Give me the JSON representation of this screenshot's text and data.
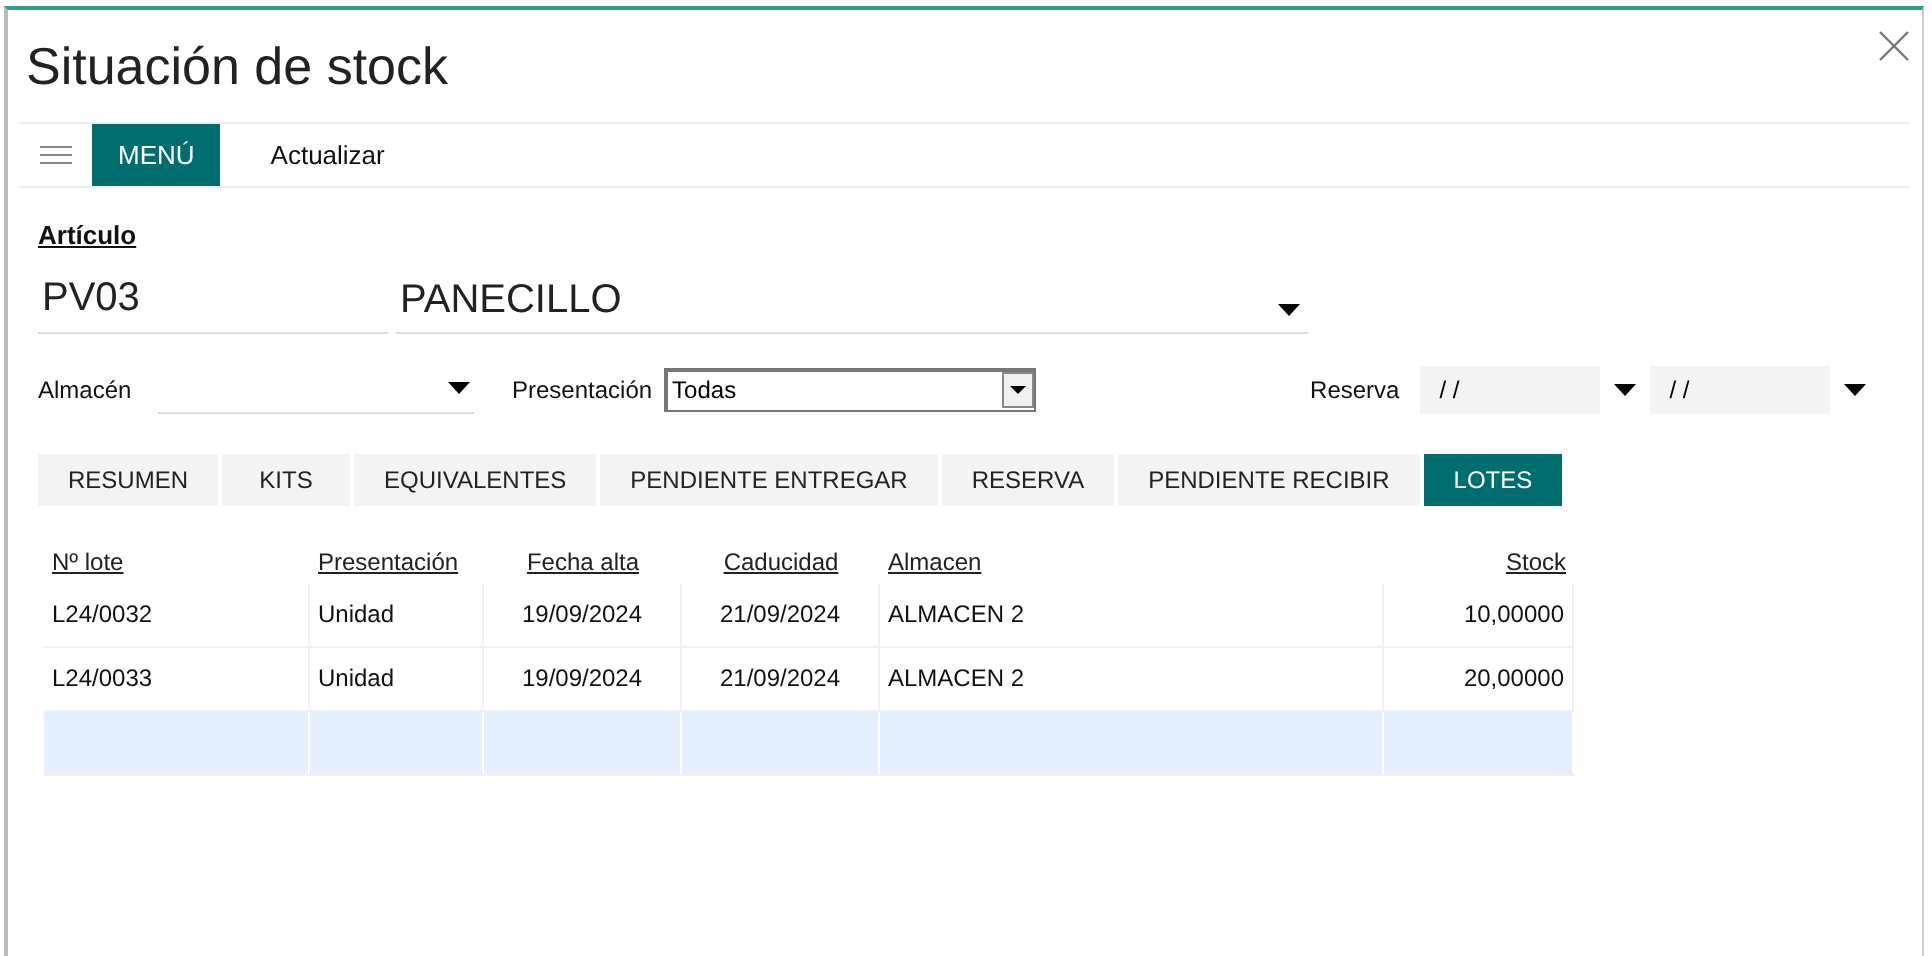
{
  "window": {
    "title": "Situación de stock"
  },
  "toolbar": {
    "menu_button": "MENÚ",
    "actions": [
      "Actualizar"
    ]
  },
  "article": {
    "label": "Artículo",
    "code": "PV03",
    "name": "PANECILLO"
  },
  "filters": {
    "almacen": {
      "label": "Almacén"
    },
    "presentacion": {
      "label": "Presentación",
      "value": "Todas"
    },
    "reserva": {
      "label": "Reserva",
      "from": "/ /",
      "to": "/ /"
    }
  },
  "tabs": [
    {
      "label": "RESUMEN",
      "selected": false
    },
    {
      "label": "KITS",
      "selected": false
    },
    {
      "label": "EQUIVALENTES",
      "selected": false
    },
    {
      "label": "PENDIENTE ENTREGAR",
      "selected": false
    },
    {
      "label": "RESERVA",
      "selected": false
    },
    {
      "label": "PENDIENTE RECIBIR",
      "selected": false
    },
    {
      "label": "LOTES",
      "selected": true
    }
  ],
  "table": {
    "columns": [
      "Nº lote",
      "Presentación",
      "Fecha alta",
      "Caducidad",
      "Almacen",
      "Stock"
    ],
    "rows": [
      {
        "cells": [
          "L24/0032",
          "Unidad",
          "19/09/2024",
          "21/09/2024",
          "ALMACEN 2",
          "10,00000"
        ],
        "selected": false
      },
      {
        "cells": [
          "L24/0033",
          "Unidad",
          "19/09/2024",
          "21/09/2024",
          "ALMACEN 2",
          "20,00000"
        ],
        "selected": false
      },
      {
        "cells": [],
        "selected": true
      }
    ]
  }
}
